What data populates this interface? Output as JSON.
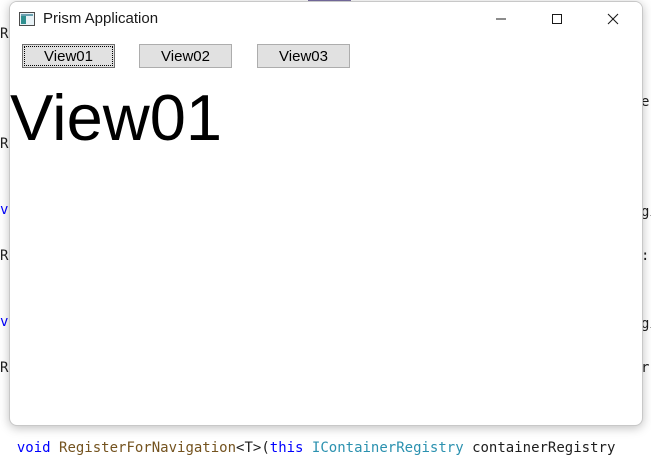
{
  "window": {
    "title": "Prism Application"
  },
  "toolbar": {
    "buttons": [
      {
        "label": "View01"
      },
      {
        "label": "View02"
      },
      {
        "label": "View03"
      }
    ]
  },
  "content": {
    "view_text": "View01"
  },
  "background_code": {
    "left_fragments": [
      "R",
      "R",
      "v",
      "R",
      "v",
      "R"
    ],
    "right_fragments": [
      "er",
      "gi",
      ":",
      "gi",
      "r"
    ],
    "bottom_line": {
      "kw1": "void",
      "method": "RegisterForNavigation",
      "generic": "<T>",
      "open": "(",
      "kw2": "this",
      "type": "IContainerRegistry",
      "rest": "containerRegistry"
    }
  },
  "icons": {
    "app": "app-window-icon",
    "minimize": "minimize-icon",
    "maximize": "maximize-icon",
    "close": "close-icon"
  }
}
